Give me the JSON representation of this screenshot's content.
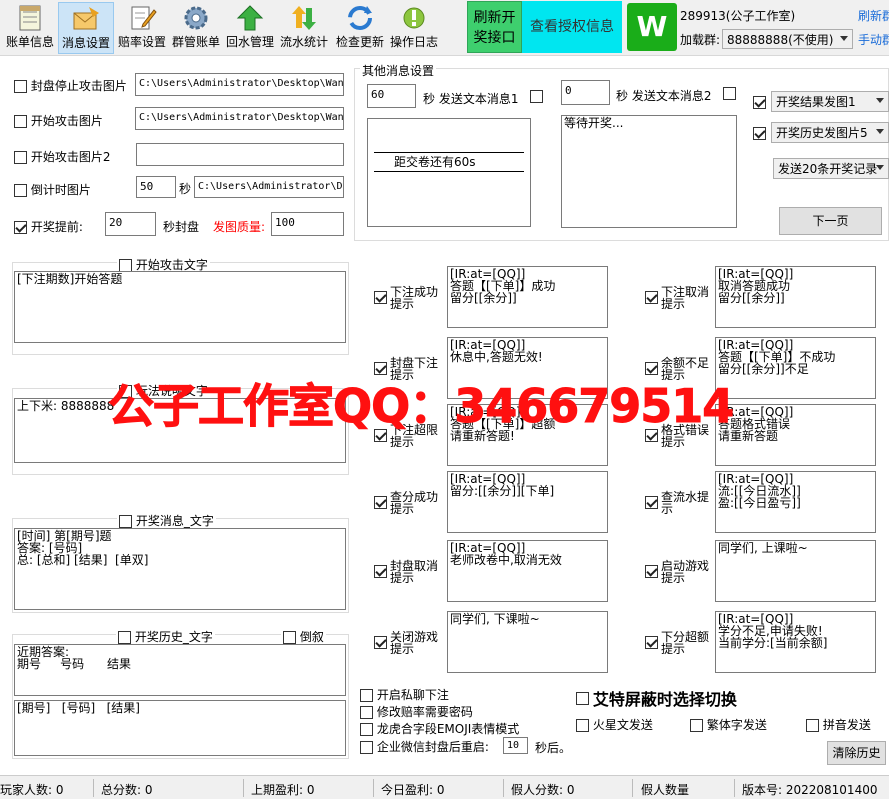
{
  "toolbar": {
    "items": [
      {
        "label": "账单信息",
        "icon": "ledger-icon"
      },
      {
        "label": "消息设置",
        "icon": "envelope-icon"
      },
      {
        "label": "赔率设置",
        "icon": "edit-icon"
      },
      {
        "label": "群管账单",
        "icon": "gear-icon"
      },
      {
        "label": "回水管理",
        "icon": "up-arrow-icon"
      },
      {
        "label": "流水统计",
        "icon": "exchange-icon"
      },
      {
        "label": "检查更新",
        "icon": "refresh-icon"
      },
      {
        "label": "操作日志",
        "icon": "log-icon"
      }
    ],
    "refresh_api": "刷新开\n奖接口",
    "auth_info": "查看授权信息",
    "account": "289913(公子工作室)",
    "load_group_label": "加载群:",
    "load_group_value": "88888888(不使用)",
    "refresh_new": "刷新群",
    "manual": "手动群"
  },
  "left": {
    "seal_stop_img": {
      "label": "封盘停止攻击图片",
      "path": "C:\\Users\\Administrator\\Desktop\\Wan"
    },
    "start_attack_img": {
      "label": "开始攻击图片",
      "path": "C:\\Users\\Administrator\\Desktop\\Wan"
    },
    "start_attack_img2": {
      "label": "开始攻击图片2",
      "path": ""
    },
    "countdown_img": {
      "label": "倒计时图片",
      "seconds": "50",
      "sec_unit": "秒",
      "path": "C:\\Users\\Administrator\\De"
    },
    "draw_ahead": {
      "label": "开奖提前:",
      "value": "20",
      "unit": "秒封盘",
      "quality_label": "发图质量:",
      "quality": "100"
    },
    "start_attack_text": {
      "label": "开始攻击文字",
      "content": "[下注期数]开始答题"
    },
    "play_desc": {
      "label": "玩法说明文字",
      "content": "上下米: 8888888"
    },
    "draw_msg": {
      "label": "开奖消息_文字",
      "content": "[时间] 第[期号]题\n答案: [号码]\n总: [总和] [结果]  [单双]"
    },
    "draw_history": {
      "label": "开奖历史_文字",
      "reverse": "倒叙",
      "content1": "近期答案:\n期号     号码      结果",
      "content2": "[期号]   [号码]   [结果]"
    }
  },
  "other": {
    "title": "其他消息设置",
    "msg1_seconds": "60",
    "msg1_label": "秒 发送文本消息1",
    "msg1_content": "距交卷还有60s",
    "msg2_seconds": "0",
    "msg2_label": "秒 发送文本消息2",
    "msg2_content": "等待开奖...",
    "draw_result_img": "开奖结果发图1",
    "draw_history_img": "开奖历史发图片5",
    "send_records": "发送20条开奖记录",
    "next_page": "下一页"
  },
  "tips": [
    {
      "label": "下注成功\n提示",
      "content": "[IR:at=[QQ]]\n答题【[下单]】成功\n留分[[余分]]"
    },
    {
      "label": "下注取消\n提示",
      "content": "[IR:at=[QQ]]\n取消答题成功\n留分[[余分]]"
    },
    {
      "label": "封盘下注\n提示",
      "content": "[IR:at=[QQ]]\n休息中,答题无效!"
    },
    {
      "label": "余额不足\n提示",
      "content": "[IR:at=[QQ]]\n答题【[下单]】不成功\n留分[[余分]]不足"
    },
    {
      "label": "下注超限\n提示",
      "content": "[IR:at=[QQ]]\n答题【[下单]】超额\n请重新答题!"
    },
    {
      "label": "格式错误\n提示",
      "content": "[IR:at=[QQ]]\n答题格式错误\n请重新答题"
    },
    {
      "label": "查分成功\n提示",
      "content": "[IR:at=[QQ]]\n留分:[[余分]][下单]"
    },
    {
      "label": "查流水提\n示",
      "content": "[IR:at=[QQ]]\n流:[[今日流水]]\n盈:[[今日盈亏]]"
    },
    {
      "label": "封盘取消\n提示",
      "content": "[IR:at=[QQ]]\n老师改卷中,取消无效"
    },
    {
      "label": "启动游戏\n提示",
      "content": "同学们, 上课啦~"
    },
    {
      "label": "关闭游戏\n提示",
      "content": "同学们, 下课啦~"
    },
    {
      "label": "下分超额\n提示",
      "content": "[IR:at=[QQ]]\n学分不足,申请失败!\n当前学分:[当前余额]"
    }
  ],
  "options": {
    "private_bet": "开启私聊下注",
    "odds_pwd": "修改赔率需要密码",
    "emoji": "龙虎合字段EMOJI表情模式",
    "wechat_restart": "企业微信封盘后重启:",
    "restart_seconds": "10",
    "restart_unit": "秒后。",
    "at_shield": "艾特屏蔽时选择切换",
    "martian": "火星文发送",
    "traditional": "繁体字发送",
    "pinyin": "拼音发送",
    "clear_history": "清除历史"
  },
  "watermark": "公子工作室QQ：346679514",
  "status": {
    "players_label": "玩家人数: 0",
    "total_score": "总分数: 0",
    "last_profit": "上期盈利: 0",
    "today_profit": "今日盈利: 0",
    "fake_score": "假人分数: 0",
    "fake_players": "假人数量",
    "version": "版本号: 202208101400"
  },
  "colors": {
    "green_btn": "#3ecf6e",
    "cyan_btn": "#00e6f0",
    "red_text": "#ff0000",
    "watermark": "#ff1010"
  }
}
